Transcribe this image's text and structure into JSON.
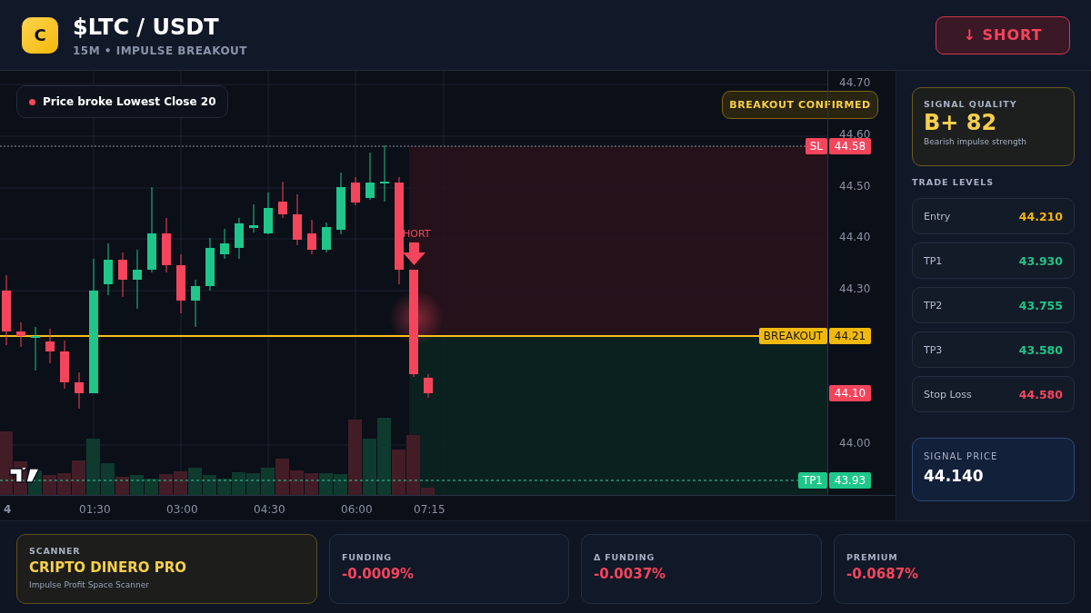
{
  "header": {
    "logo_letter": "C",
    "pair": "$LTC / USDT",
    "subtitle": "15M • IMPULSE BREAKOUT",
    "action_button": {
      "label": "↓ SHORT"
    }
  },
  "chart": {
    "alert": {
      "text": "Price broke Lowest Close 20"
    },
    "status_badge": "BREAKOUT CONFIRMED",
    "marker_label": "HORT",
    "price_axis": [
      "44.70",
      "44.60",
      "44.50",
      "44.40",
      "44.30",
      "44.00"
    ],
    "time_axis": [
      "4",
      "01:30",
      "03:00",
      "04:30",
      "06:00",
      "07:15"
    ],
    "levels": [
      {
        "kind": "stop",
        "label": "SL",
        "price": "44.58"
      },
      {
        "kind": "breakout",
        "label": "BREAKOUT",
        "price": "44.21"
      },
      {
        "kind": "current",
        "price": "44.10"
      },
      {
        "kind": "target",
        "label": "TP1",
        "price": "43.93"
      }
    ]
  },
  "signal_quality": {
    "title": "SIGNAL QUALITY",
    "grade": "B+ 82",
    "caption": "Bearish impulse strength"
  },
  "trade_levels": {
    "title": "TRADE LEVELS",
    "rows": [
      {
        "kind": "entry",
        "label": "Entry",
        "value": "44.210"
      },
      {
        "kind": "target",
        "label": "TP1",
        "value": "43.930"
      },
      {
        "kind": "target",
        "label": "TP2",
        "value": "43.755"
      },
      {
        "kind": "target",
        "label": "TP3",
        "value": "43.580"
      },
      {
        "kind": "stop",
        "label": "Stop Loss",
        "value": "44.580"
      }
    ]
  },
  "signal_price": {
    "label": "SIGNAL PRICE",
    "value": "44.140"
  },
  "stats": [
    {
      "kind": "scanner",
      "label": "SCANNER",
      "value": "CRIPTO DINERO PRO",
      "caption": "Impulse Profit Space Scanner"
    },
    {
      "kind": "metric",
      "label": "FUNDING",
      "value": "-0.0009%"
    },
    {
      "kind": "metric",
      "label": "Δ FUNDING",
      "value": "-0.0037%"
    },
    {
      "kind": "metric",
      "label": "PREMIUM",
      "value": "-0.0687%"
    }
  ]
}
